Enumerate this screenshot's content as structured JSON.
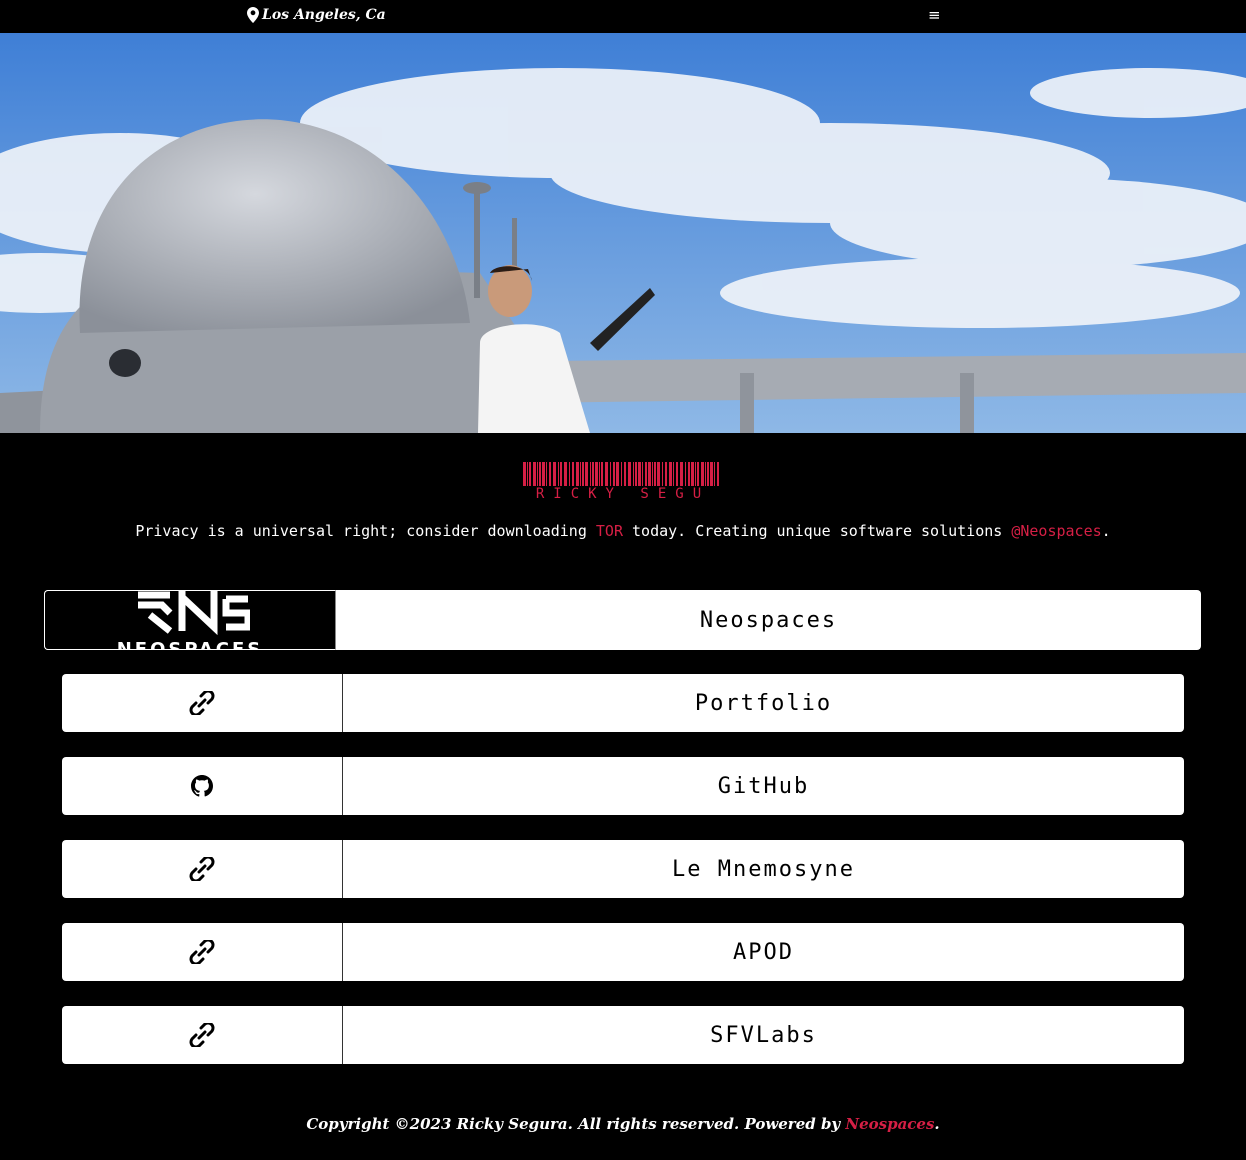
{
  "header": {
    "location": "Los Angeles, Ca",
    "location_icon": "map-pin-icon",
    "menu_icon": "hamburger-menu-icon",
    "menu_glyph": "≡"
  },
  "hero": {
    "image_icon": "hero-photo"
  },
  "brand": {
    "name": "RICKY SEGU",
    "accent_color": "#d61f45"
  },
  "tagline": {
    "prefix": "Privacy is a universal right; consider downloading ",
    "tor_link": "TOR",
    "middle": " today. Creating unique software solutions ",
    "neospaces_link": "@Neospaces",
    "suffix": "."
  },
  "links": [
    {
      "label": "Neospaces",
      "icon": "neospaces-logo",
      "logo_text": "NEOSPACES"
    },
    {
      "label": "Portfolio",
      "icon": "link-icon"
    },
    {
      "label": "GitHub",
      "icon": "github-icon"
    },
    {
      "label": "Le Mnemosyne",
      "icon": "link-icon"
    },
    {
      "label": "APOD",
      "icon": "link-icon"
    },
    {
      "label": "SFVLabs",
      "icon": "link-icon"
    }
  ],
  "footer": {
    "text": "Copyright ©2023 Ricky Segura. All rights reserved. Powered by ",
    "link": "Neospaces",
    "suffix": "."
  }
}
